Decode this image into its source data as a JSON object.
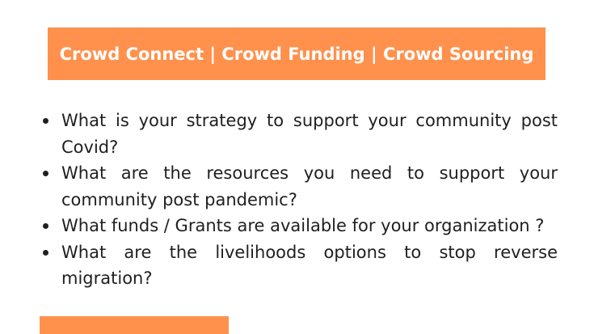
{
  "banner": {
    "title": "Crowd Connect | Crowd Funding | Crowd Sourcing",
    "color": "#ff914d"
  },
  "questions": [
    "What is your strategy to support your community post Covid?",
    "What are the resources you need to support your community post pandemic?",
    "What funds / Grants are available for your organization ?",
    "What are the livelihoods options to stop reverse migration?"
  ],
  "colors": {
    "accent": "#ff914d",
    "text": "#1f1f1f",
    "background": "#ffffff"
  }
}
